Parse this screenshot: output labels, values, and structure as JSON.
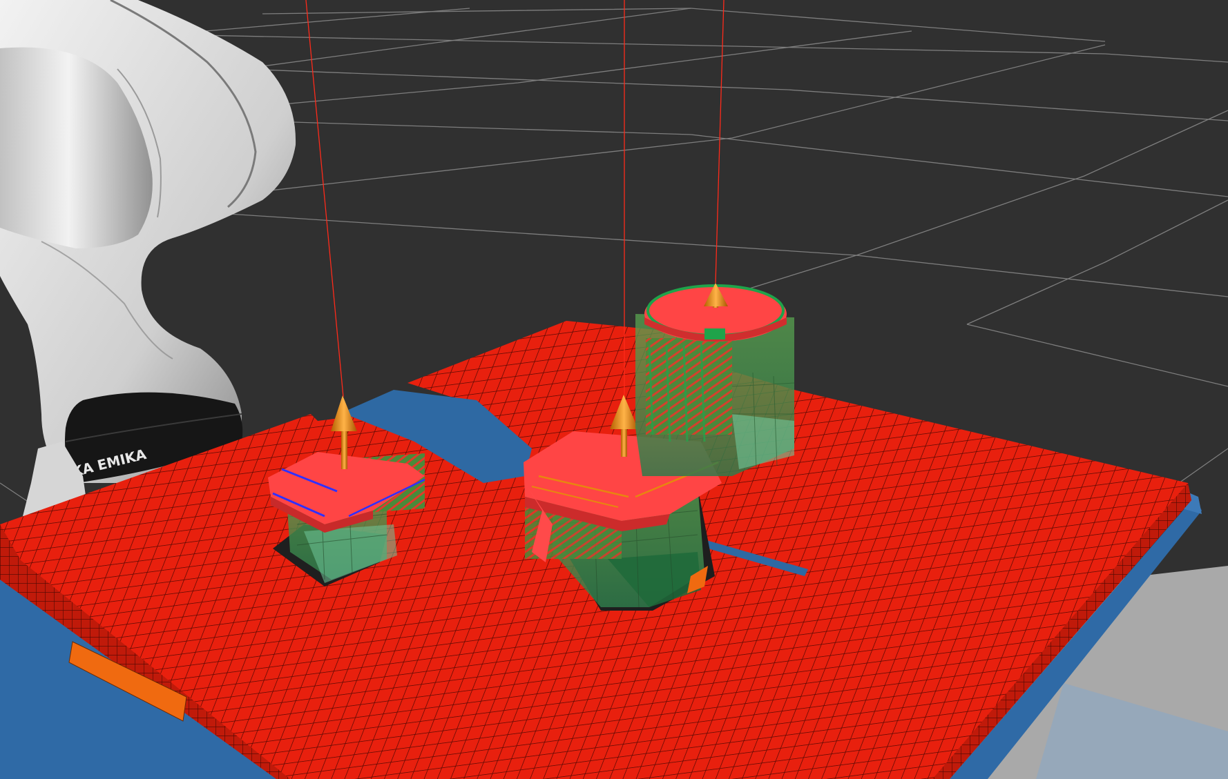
{
  "app": {
    "view": "3d-render-viewport"
  },
  "scene": {
    "background_color": "#303030",
    "grid_color": "#8c8c8c",
    "table_tile_color": "#e8200e",
    "table_tile_line_color": "#5a0a04",
    "table_base_color": "#2f6aa6",
    "blue_region_color": "#2e69a3",
    "grasp_pose_color": "#ff4040",
    "grasp_arrow_color": "#e8860f",
    "ray_color": "#ff2a1a",
    "object_volume_color": "#3c9a4c",
    "robot_body_color": "#e6e6e6",
    "robot_ring_color": "#151515",
    "robot_brand_text": "EMIKA",
    "robot_brand_text_partial": "NKA EMIKA",
    "objects": [
      {
        "name": "left-box-object",
        "type": "box"
      },
      {
        "name": "center-box-object",
        "type": "box"
      },
      {
        "name": "cylinder-object",
        "type": "cylinder"
      }
    ],
    "grasp_markers": [
      {
        "name": "left-grasp-marker",
        "arrow": "up"
      },
      {
        "name": "center-grasp-marker",
        "arrow": "up"
      },
      {
        "name": "cylinder-grasp-marker",
        "arrow": "up"
      }
    ]
  }
}
